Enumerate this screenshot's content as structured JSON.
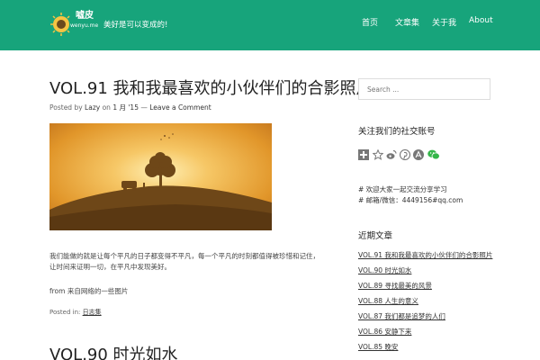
{
  "header": {
    "logo_text": "嘘皮",
    "logo_sub": "wenyu.me",
    "tagline": "美好是可以变成的!",
    "nav": [
      "首页",
      "文章集",
      "关于我",
      "About"
    ]
  },
  "posts": [
    {
      "title": "VOL.91 我和我最喜欢的小伙伴们的合影照片",
      "meta_prefix": "Posted by",
      "author": "Lazy",
      "meta_on": "on",
      "date": "1 月 '15",
      "comment": "Leave a Comment",
      "excerpt": "我们能做的就是让每个平凡的日子都变得不平凡，每一个平凡的时刻都值得被珍惜和记住，让时间来证明一切，在平凡中发现美好。",
      "from": "from 来自网络的一些图片",
      "posted_in_label": "Posted in:",
      "category": "日志集"
    },
    {
      "title": "VOL.90 时光如水"
    }
  ],
  "sidebar": {
    "search_placeholder": "Search ...",
    "follow_title": "关注我们的社交账号",
    "social_icons": [
      "plus-icon",
      "star-icon",
      "weibo-icon",
      "pinterest-icon",
      "artstation-icon",
      "wechat-icon"
    ],
    "contact_line1": "# 欢迎大家一起交流分享学习",
    "contact_line2": "# 邮箱/微信：4449156#qq.com",
    "recent_title": "近期文章",
    "recent_posts": [
      "VOL.91 我和我最喜欢的小伙伴们的合影照片",
      "VOL.90 时光如水",
      "VOL.89 寻找最美的风景",
      "VOL.88 人生的意义",
      "VOL.87 我们都是追梦的人们",
      "VOL.86 安静下来",
      "VOL.85 晚安"
    ]
  },
  "colors": {
    "header_bg": "#17a47b",
    "wechat": "#35b64a"
  }
}
